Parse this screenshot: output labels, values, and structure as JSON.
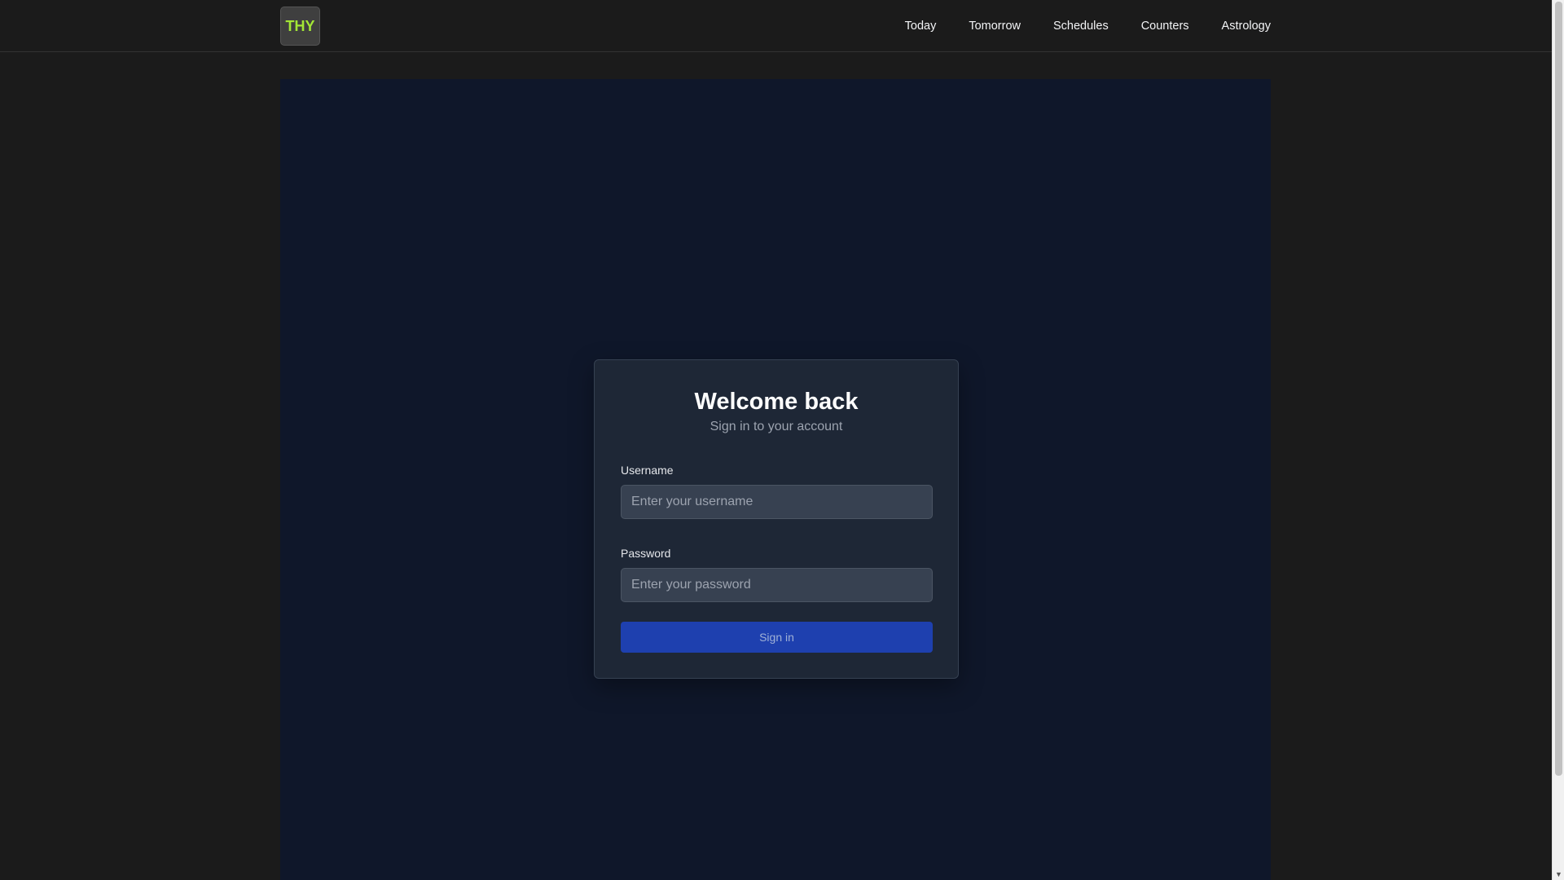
{
  "header": {
    "logo_text": "THY",
    "nav": [
      "Today",
      "Tomorrow",
      "Schedules",
      "Counters",
      "Astrology"
    ]
  },
  "login": {
    "title": "Welcome back",
    "subtitle": "Sign in to your account",
    "username_label": "Username",
    "username_placeholder": "Enter your username",
    "password_label": "Password",
    "password_placeholder": "Enter your password",
    "submit_label": "Sign in"
  },
  "colors": {
    "logo_accent": "#a3e635",
    "panel_bg": "#0f172a",
    "card_bg": "#1e2736",
    "button_bg": "#1e40af"
  },
  "icons": {
    "scroll_down": "chevron-down-icon"
  }
}
